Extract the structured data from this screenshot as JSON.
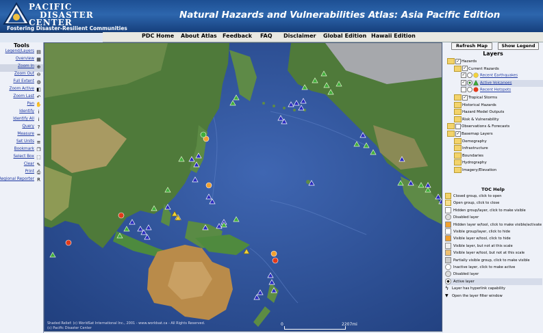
{
  "header": {
    "logo_line1": "PACIFIC",
    "logo_line2": "DISASTER",
    "logo_line3": "CENTER",
    "tagline": "Fostering Disaster-Resilient Communities",
    "title": "Natural Hazards and Vulnerabilities Atlas: Asia Pacific Edition"
  },
  "nav": [
    "PDC Home",
    "About Atlas",
    "Feedback",
    "FAQ",
    "Disclaimer",
    "Global Edition",
    "Hawaii Edition"
  ],
  "tools": {
    "title": "Tools",
    "items": [
      {
        "label": "Legend/Layers",
        "icon": "legend-icon",
        "glyph": "▤"
      },
      {
        "label": "Overview",
        "icon": "overview-map-icon",
        "glyph": "▦"
      },
      {
        "label": "Zoom In",
        "icon": "zoom-in-icon",
        "glyph": "⊕",
        "active": true
      },
      {
        "label": "Zoom Out",
        "icon": "zoom-out-icon",
        "glyph": "⊖"
      },
      {
        "label": "Full Extent",
        "icon": "globe-icon",
        "glyph": "◍"
      },
      {
        "label": "Zoom Active",
        "icon": "zoom-active-icon",
        "glyph": "◧"
      },
      {
        "label": "Zoom Last",
        "icon": "zoom-last-icon",
        "glyph": "↶"
      },
      {
        "label": "Pan",
        "icon": "hand-icon",
        "glyph": "✋"
      },
      {
        "label": "Identify",
        "icon": "info-icon",
        "glyph": "i"
      },
      {
        "label": "Identify All",
        "icon": "identify-all-icon",
        "glyph": "i"
      },
      {
        "label": "Query",
        "icon": "query-icon",
        "glyph": "?"
      },
      {
        "label": "Measure",
        "icon": "ruler-icon",
        "glyph": "═"
      },
      {
        "label": "Set Units",
        "icon": "units-icon",
        "glyph": "≡"
      },
      {
        "label": "Bookmark",
        "icon": "bookmark-icon",
        "glyph": "❐"
      },
      {
        "label": "Select Box",
        "icon": "select-box-icon",
        "glyph": "⬚"
      },
      {
        "label": "Clear",
        "icon": "clear-icon",
        "glyph": "✎"
      },
      {
        "label": "Print",
        "icon": "printer-icon",
        "glyph": "⎙"
      },
      {
        "label": "Regional Reporter",
        "icon": "reporter-icon",
        "glyph": "R"
      }
    ]
  },
  "map": {
    "credit1": "Shaded Relief: (c) WorldSat International Inc., 2001 - www.worldsat.ca - All Rights Reserved.",
    "credit2": "(c) Pacific Disaster Center",
    "scale_zero": "0",
    "scale_label": "2207mi"
  },
  "right": {
    "refresh_label": "Refresh Map",
    "legend_label": "Show Legend",
    "layers_title": "Layers",
    "layers": [
      {
        "label": "Hazards",
        "indent": 0,
        "folder": true,
        "check": "✓"
      },
      {
        "label": "Current Hazards",
        "indent": 1,
        "folder": true,
        "check": "✓"
      },
      {
        "label": "Recent Earthquakes",
        "indent": 2,
        "check": "✓",
        "radio": true,
        "symbol": "quake",
        "link": true
      },
      {
        "label": "Active Volcanoes",
        "indent": 2,
        "check": "✓",
        "radio": true,
        "symbol": "volcano",
        "link": true,
        "active": true
      },
      {
        "label": "Recent Hotspots",
        "indent": 2,
        "check": "",
        "radio": true,
        "symbol": "hotspot",
        "link": true
      },
      {
        "label": "Tropical Storms",
        "indent": 1,
        "folder": true,
        "check": "✓"
      },
      {
        "label": "Historical Hazards",
        "indent": 1,
        "folder": true
      },
      {
        "label": "Hazard Model Outputs",
        "indent": 1,
        "folder": true
      },
      {
        "label": "Risk & Vulnerability",
        "indent": 1,
        "folder": true
      },
      {
        "label": "Observations & Forecasts",
        "indent": 0,
        "folder": true,
        "check": ""
      },
      {
        "label": "Basemap Layers",
        "indent": 0,
        "folder": true,
        "check": "✓"
      },
      {
        "label": "Demography",
        "indent": 1,
        "folder": true
      },
      {
        "label": "Infrastructure",
        "indent": 1,
        "folder": true
      },
      {
        "label": "Boundaries",
        "indent": 1,
        "folder": true
      },
      {
        "label": "Hydrography",
        "indent": 1,
        "folder": true
      },
      {
        "label": "Imagery/Elevation",
        "indent": 1,
        "folder": true
      }
    ],
    "toc_title": "TOC Help",
    "toc": [
      {
        "label": "Closed group, click to open",
        "icon": "closed-folder-icon"
      },
      {
        "label": "Open group, click to close",
        "icon": "open-folder-icon"
      },
      {
        "label": "Hidden group/layer, click to make visible",
        "icon": "hidden-layer-icon"
      },
      {
        "label": "Disabled layer",
        "icon": "disabled-layer-icon"
      },
      {
        "label": "Hidden layer w/tool, click to make visible/activate",
        "icon": "hidden-tool-icon"
      },
      {
        "label": "Visible group/layer, click to hide",
        "icon": "visible-layer-icon"
      },
      {
        "label": "Visible layer w/tool, click to hide",
        "icon": "visible-tool-icon"
      },
      {
        "label": "Visible layer, but not at this scale",
        "icon": "scale-icon"
      },
      {
        "label": "Visible layer w/tool, but not at this scale",
        "icon": "scale-tool-icon"
      },
      {
        "label": "Partially visible group, click to make visible",
        "icon": "partial-icon"
      },
      {
        "label": "Inactive layer, click to make active",
        "icon": "inactive-icon"
      },
      {
        "label": "Disabled layer",
        "icon": "disabled-radio-icon"
      },
      {
        "label": "Active layer",
        "icon": "active-layer-icon"
      },
      {
        "label": "Layer has hyperlink capability",
        "icon": "lightning-icon"
      },
      {
        "label": "Open the layer filter window",
        "icon": "filter-icon"
      }
    ]
  }
}
